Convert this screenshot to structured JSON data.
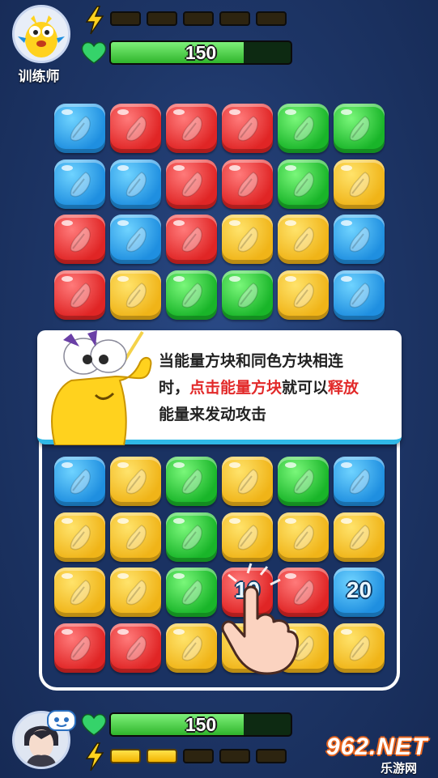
{
  "opponent": {
    "name": "训练师",
    "hp": 150,
    "hp_fraction": 0.74,
    "energy_total": 5,
    "energy_filled": 0
  },
  "player": {
    "hp": 150,
    "hp_fraction": 0.74,
    "energy_total": 5,
    "energy_filled": 2
  },
  "board": {
    "columns": 6,
    "rows_top": [
      [
        "blue",
        "red",
        "red",
        "red",
        "green",
        "green"
      ],
      [
        "blue",
        "blue",
        "red",
        "red",
        "green",
        "yellow"
      ],
      [
        "red",
        "blue",
        "red",
        "yellow",
        "yellow",
        "blue"
      ],
      [
        "red",
        "yellow",
        "green",
        "green",
        "yellow",
        "blue"
      ]
    ],
    "rows_bottom": [
      [
        "blue",
        "yellow",
        "green",
        "yellow",
        "green",
        "blue"
      ],
      [
        "yellow",
        "yellow",
        "green",
        "yellow",
        "yellow",
        "yellow"
      ],
      [
        "yellow",
        "yellow",
        "green",
        "red",
        "red",
        "blue"
      ],
      [
        "red",
        "red",
        "yellow",
        "yellow",
        "yellow",
        "yellow"
      ]
    ],
    "power_tiles": [
      {
        "row": 6,
        "col": 3,
        "label": "10"
      },
      {
        "row": 6,
        "col": 5,
        "label": "20"
      }
    ]
  },
  "tutorial": {
    "line1": "当能量方块和同色方块相连",
    "line2_a": "时，",
    "line2_hl1": "点击能量方块",
    "line2_b": "就可以",
    "line2_hl2": "释放",
    "line3": "能量来发动攻击"
  },
  "watermark": {
    "brand": "962.NET",
    "sub": "乐游网"
  },
  "colors": {
    "blue": "#1f8fe0",
    "red": "#e02525",
    "green": "#19b529",
    "yellow": "#f0b418",
    "highlight": "#e22a2a",
    "hp": "#2fb52b"
  }
}
